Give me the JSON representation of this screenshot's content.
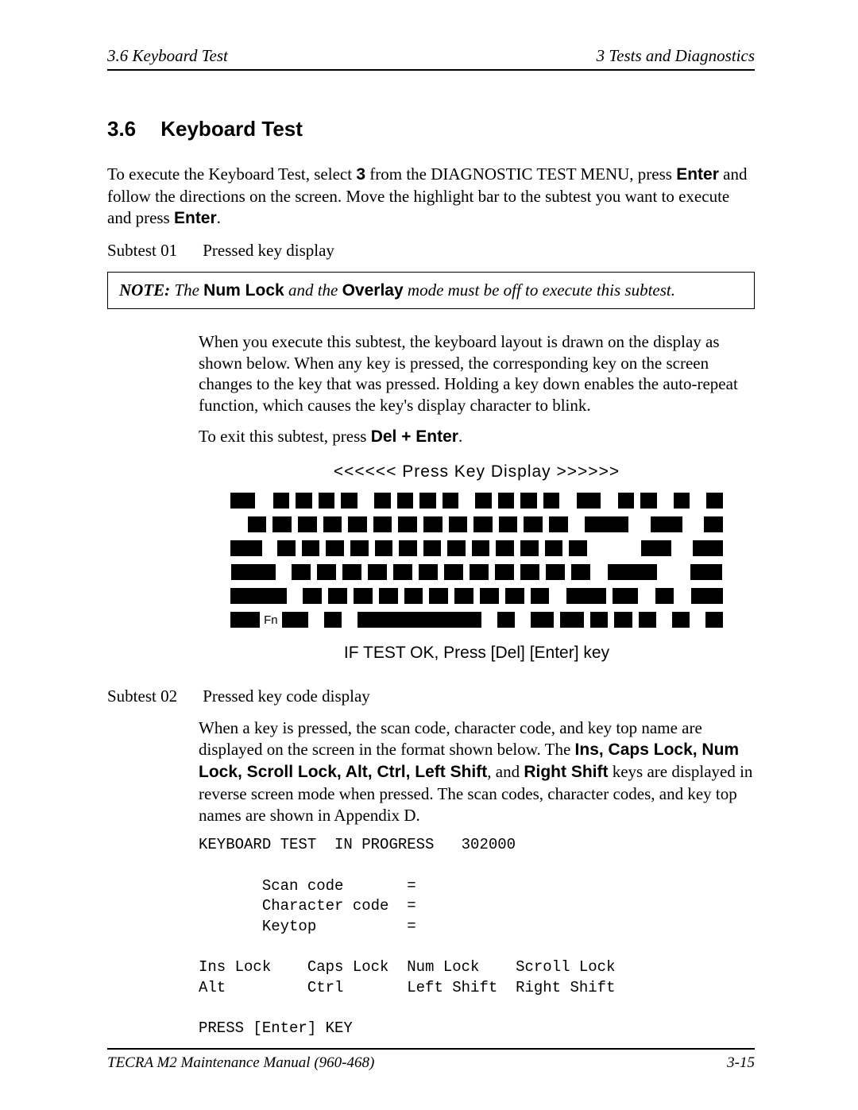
{
  "header": {
    "left": "3.6  Keyboard Test",
    "right": "3  Tests and Diagnostics"
  },
  "heading": {
    "number": "3.6",
    "title": "Keyboard Test"
  },
  "intro": {
    "p1_a": "To execute the Keyboard Test, select ",
    "p1_b": "3",
    "p1_c": " from the DIAGNOSTIC TEST MENU, press ",
    "p1_d": "Enter",
    "p1_e": " and follow the directions on the screen. Move the highlight bar to the subtest you want to execute and press ",
    "p1_f": "Enter",
    "p1_g": "."
  },
  "subtest01": {
    "label": "Subtest 01",
    "title": "Pressed key display"
  },
  "note": {
    "label": "NOTE:",
    "pre": "   The ",
    "b1": "Num Lock",
    "mid": " and the ",
    "b2": "Overlay",
    "post": " mode must be off to execute this subtest."
  },
  "s01_para1": "When you execute this subtest, the keyboard layout is drawn on the display as shown below. When any key is pressed, the corresponding key on the screen changes to the key that was pressed. Holding a key down enables the auto-repeat function, which causes the key's display character to blink.",
  "s01_para2_a": "To exit this subtest, press ",
  "s01_para2_b": "Del + Enter",
  "s01_para2_c": ".",
  "diagram": {
    "title": "<<<<<<   Press Key Display   >>>>>>",
    "fn": "Fn",
    "footer": "IF TEST OK, Press [Del] [Enter] key"
  },
  "subtest02": {
    "label": "Subtest 02",
    "title": "Pressed key code display"
  },
  "s02_para": {
    "a": "When a key is pressed, the scan code, character code, and key top name are displayed on the screen in the format shown below. The ",
    "b1": "Ins, Caps Lock, Num Lock, Scroll Lock, Alt, Ctrl, Left Shift",
    "mid": ", and ",
    "b2": "Right Shift",
    "c": " keys are displayed in reverse screen mode when pressed. The scan codes, character codes, and key top names are shown in Appendix D."
  },
  "mono": "KEYBOARD TEST  IN PROGRESS   302000\n\n       Scan code       =\n       Character code  =\n       Keytop          =\n\nIns Lock    Caps Lock  Num Lock    Scroll Lock\nAlt         Ctrl       Left Shift  Right Shift\n\nPRESS [Enter] KEY",
  "footer": {
    "left": "TECRA M2 Maintenance Manual (960-468)",
    "right": "3-15"
  }
}
